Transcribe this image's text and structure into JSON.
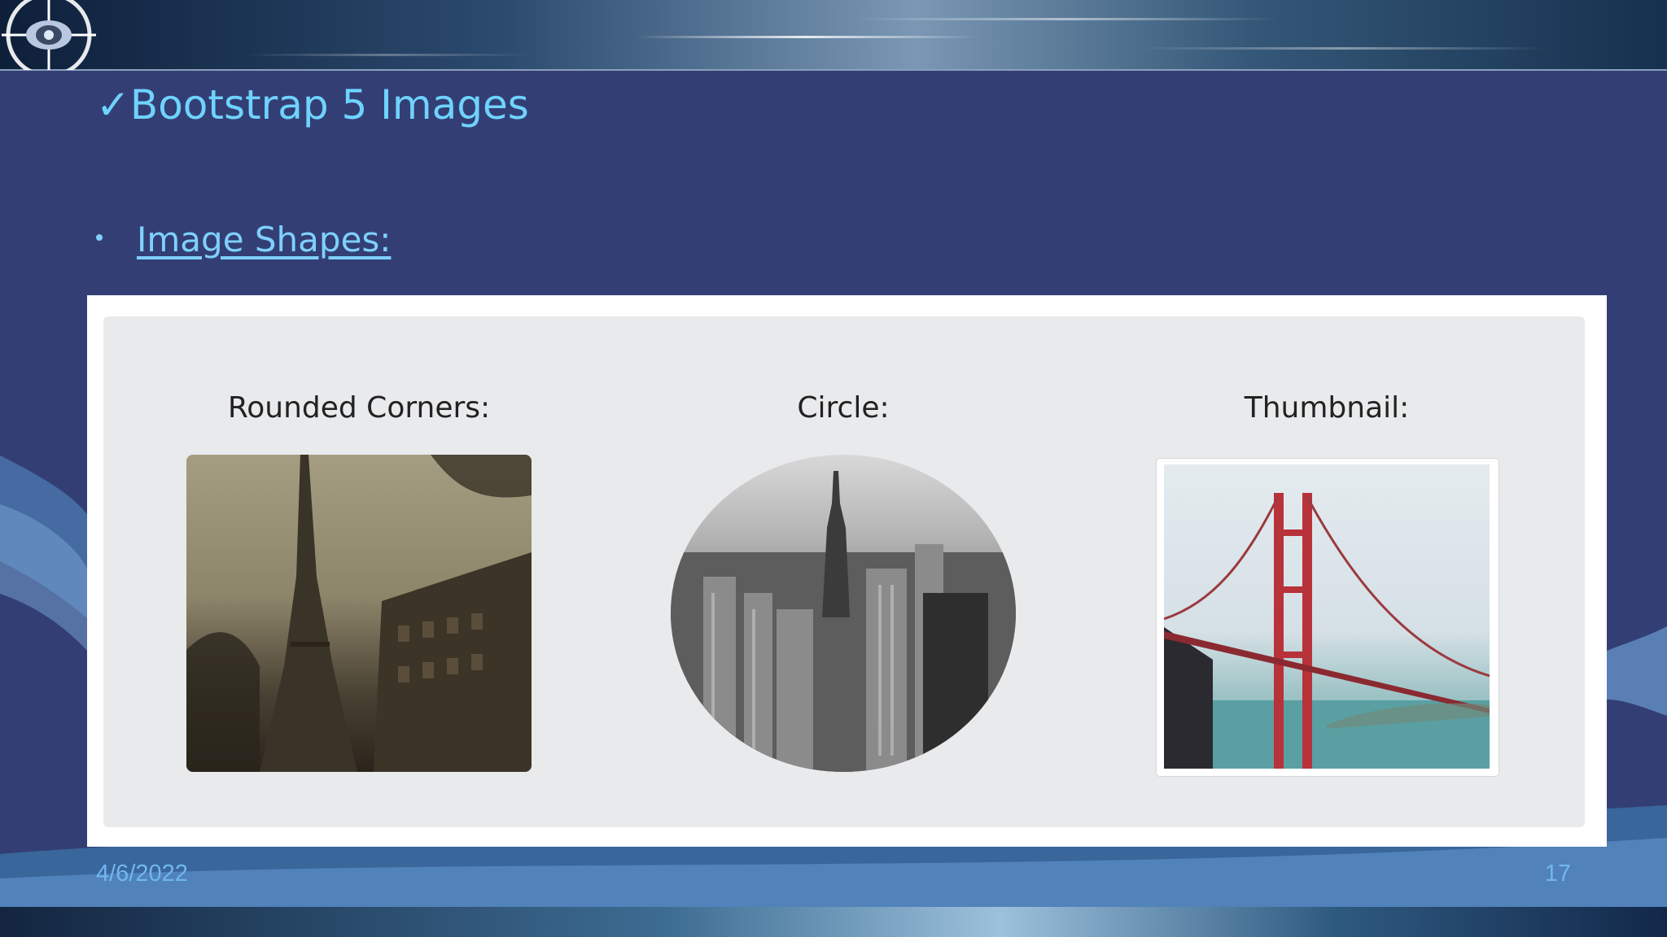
{
  "slide": {
    "checkmark": "✓",
    "title": "Bootstrap 5 Images",
    "bullet": "Image Shapes:",
    "footer_date": "4/6/2022",
    "page_number": "17"
  },
  "screenshot": {
    "captions": {
      "rounded": "Rounded Corners:",
      "circle": "Circle:",
      "thumbnail": "Thumbnail:"
    },
    "images": {
      "rounded": "paris-eiffel-tower-photo",
      "circle": "new-york-skyline-photo",
      "thumbnail": "golden-gate-bridge-photo"
    }
  },
  "colors": {
    "background": "#333f74",
    "title": "#6fd3ff",
    "bullet": "#7fd0ff",
    "footer": "#6fb8ef",
    "panel": "#e9eaec"
  }
}
